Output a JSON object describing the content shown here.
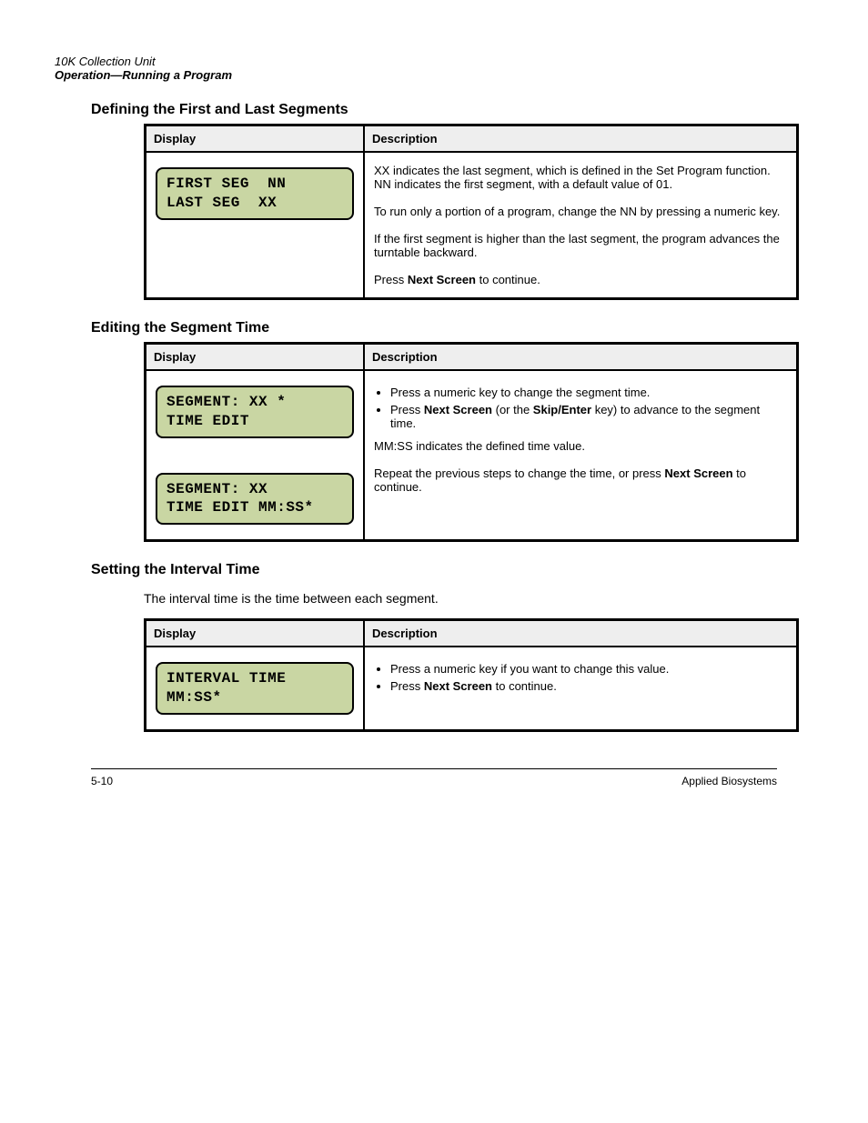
{
  "pageHeader": {
    "title": "10K Collection Unit",
    "subtitle": "Operation—Running a Program"
  },
  "sections": [
    {
      "heading": "Defining the First and Last Segments",
      "table": {
        "h1": "Display",
        "h2": "Description",
        "lcd": [
          "FIRST SEG  NN\nLAST SEG  XX"
        ],
        "desc": "XX indicates the last segment, which is defined in the Set Program function. NN indicates the first segment, with a default value of 01.<br><br>To run only a portion of a program, change the NN by pressing a numeric key.<br><br>If the first segment is higher than the last segment, the program advances the turntable backward.<br><br>Press <b>Next Screen</b> to continue."
      }
    },
    {
      "heading": "Editing the Segment Time",
      "table": {
        "h1": "Display",
        "h2": "Description",
        "lcd": [
          "SEGMENT: XX *\nTIME EDIT",
          "SEGMENT: XX\nTIME EDIT MM:SS*"
        ],
        "desc": "<ul><li>Press a numeric key to change the segment time.</li><li>Press <b>Next Screen</b> (or the <b>Skip/Enter</b> key) to advance to the segment time.</li></ul>MM:SS indicates the defined time value.<br><br>Repeat the previous steps to change the time, or press <b>Next Screen</b> to continue."
      }
    },
    {
      "heading": "Setting the Interval Time",
      "caption": "The interval time is the time between each segment.",
      "table": {
        "h1": "Display",
        "h2": "Description",
        "lcd": [
          "INTERVAL TIME\nMM:SS*"
        ],
        "desc": "<ul><li>Press a numeric key if you want to change this value.</li><li>Press <b>Next Screen</b> to continue.</li></ul>"
      }
    }
  ],
  "footer": {
    "left": "5-10",
    "right": "Applied Biosystems"
  }
}
